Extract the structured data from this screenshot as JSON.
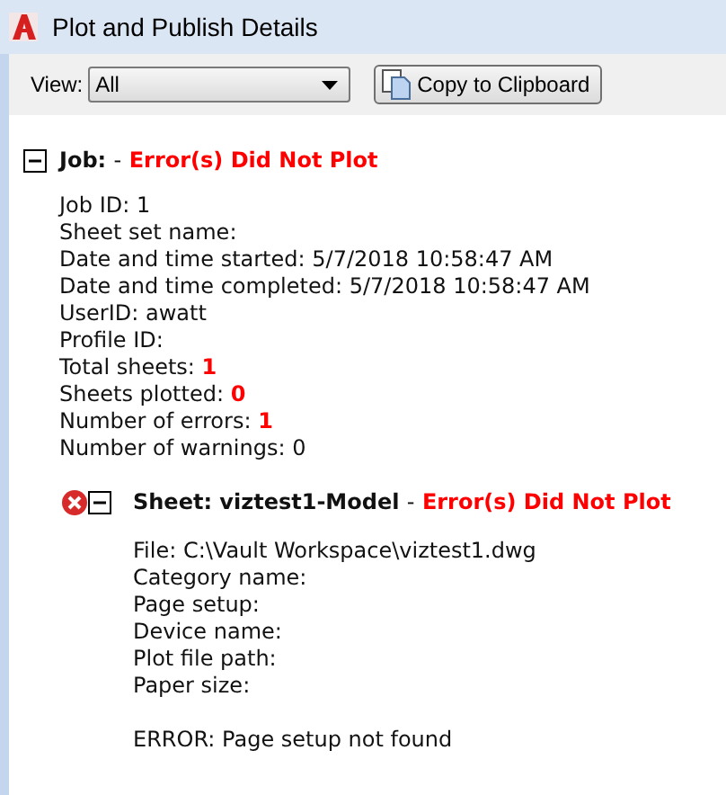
{
  "window": {
    "title": "Plot and Publish Details"
  },
  "toolbar": {
    "view_label": "View:",
    "view_value": "All",
    "copy_button": "Copy to Clipboard"
  },
  "job": {
    "expanded": true,
    "label": "Job:",
    "separator": "-",
    "status": "Error(s) Did Not Plot",
    "lines": [
      {
        "label": "Job ID:",
        "value": "1",
        "alert": false
      },
      {
        "label": "Sheet set name:"
      },
      {
        "label": "Date and time started:",
        "value": "5/7/2018 10:58:47 AM",
        "alert": false
      },
      {
        "label": "Date and time completed:",
        "value": "5/7/2018 10:58:47 AM",
        "alert": false
      },
      {
        "label": "UserID:",
        "value": "awatt",
        "alert": false
      },
      {
        "label": "Profile ID:"
      },
      {
        "label": "Total sheets:",
        "value": "1",
        "alert": true
      },
      {
        "label": "Sheets plotted:",
        "value": "0",
        "alert": true
      },
      {
        "label": "Number of errors:",
        "value": "1",
        "alert": true
      },
      {
        "label": "Number of warnings:",
        "value": "0",
        "alert": false
      }
    ],
    "sheets": [
      {
        "expanded": true,
        "error": true,
        "label": "Sheet: viztest1-Model",
        "separator": "-",
        "status": "Error(s) Did Not Plot",
        "lines": [
          {
            "label": "File:",
            "value": "C:\\Vault Workspace\\viztest1.dwg",
            "alert": false
          },
          {
            "label": "Category name:"
          },
          {
            "label": "Page setup:"
          },
          {
            "label": "Device name:"
          },
          {
            "label": "Plot file path:"
          },
          {
            "label": "Paper size:"
          }
        ],
        "message": "ERROR: Page setup not found"
      }
    ]
  }
}
